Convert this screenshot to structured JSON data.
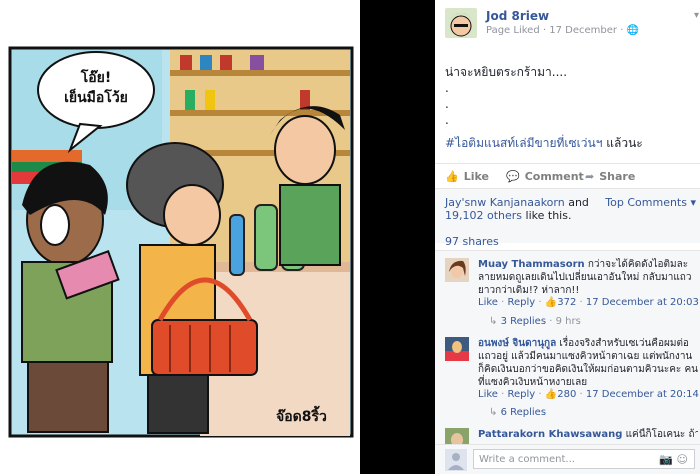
{
  "post": {
    "page_name": "Jod 8riew",
    "meta_status": "Page Liked",
    "meta_sep": "·",
    "meta_date": "17 December",
    "meta_sep2": "·",
    "text_line1": "น่าจะหยิบตระกร้ามา....",
    "dot1": ".",
    "dot2": ".",
    "dot3": ".",
    "hashtag": "#ไอติมแนสท์เล่มีขายที่เซเว่นฯ",
    "hashtag_suffix": " แล้วนะ"
  },
  "comic": {
    "speech_line1": "โอ๊ย!",
    "speech_line2": "เย็นมือโว้ย",
    "signature": "จ๊อด8ริ้ว"
  },
  "actions": {
    "like": "Like",
    "comment": "Comment",
    "share": "Share"
  },
  "likes": {
    "names": "Jay'snw Kanjanaakorn",
    "and": " and ",
    "others": "19,102 others",
    "suffix": " like this.",
    "top_comments": "Top Comments ▾",
    "shares": "97 shares"
  },
  "comments": [
    {
      "author": "Muay Thammasorn",
      "text": " กว่าจะได้คิดดังไอติมละลายหมดถูเลยเดินไปเปลี่ยนเอาอันใหม่ กลับมาแถวยาวกว่าเดิม!? ห่าลาก!!",
      "like": "Like",
      "reply": "Reply",
      "sep": "·",
      "count": "372",
      "time": "17 December at 20:03",
      "replies": "3 Replies",
      "ago": " · 9 hrs"
    },
    {
      "author": "อนพงษ์ จินดานุกูล",
      "text": " เรื่องจริงสำหรับเซเว่นคือผมต่อแถวอยู่ แล้วมีคนมาแซงคิวหน้าตาเฉย แต่พนักงานก็คิดเงินบอกว่าขอคิดเงินให้ผมก่อนตามคิวนะคะ คนที่แซงคิวเงิบหน้าหงายเลย",
      "like": "Like",
      "reply": "Reply",
      "sep": "·",
      "count": "280",
      "time": "17 December at 20:14",
      "replies": "6 Replies",
      "ago": ""
    },
    {
      "author": "Pattarakorn Khawsawang",
      "text": " แค่นี้ก็โอเคนะ ถ้าเซเว่นหน้า"
    }
  ],
  "write_comment": {
    "placeholder": "Write a comment..."
  },
  "colors": {
    "link": "#365899",
    "muted": "#90949c",
    "panel": "#f6f7f9"
  }
}
